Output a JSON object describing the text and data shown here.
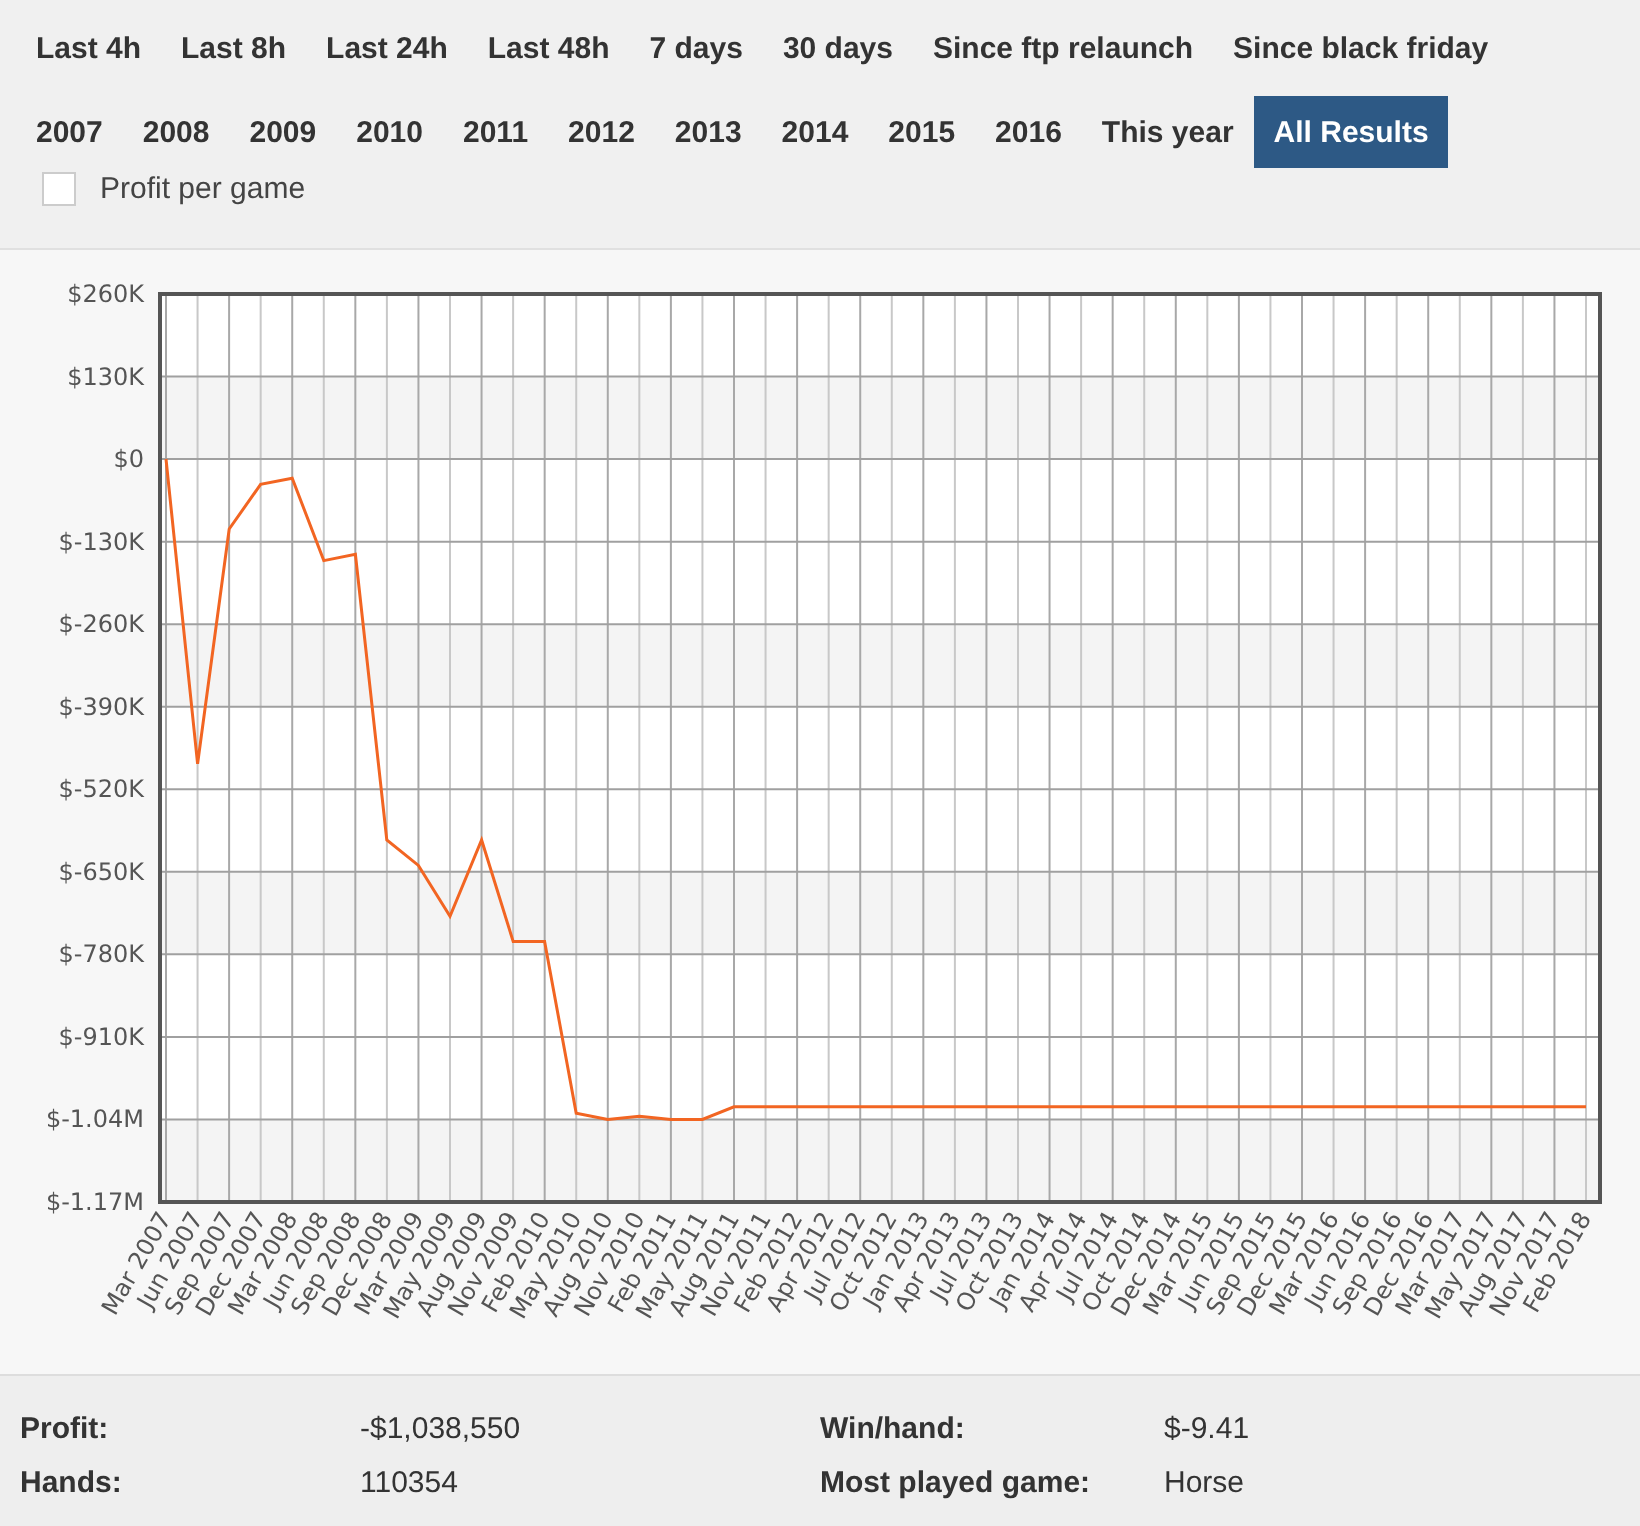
{
  "periods": [
    {
      "label": "Last 4h",
      "selected": false
    },
    {
      "label": "Last 8h",
      "selected": false
    },
    {
      "label": "Last 24h",
      "selected": false
    },
    {
      "label": "Last 48h",
      "selected": false
    },
    {
      "label": "7 days",
      "selected": false
    },
    {
      "label": "30 days",
      "selected": false
    },
    {
      "label": "Since ftp relaunch",
      "selected": false
    },
    {
      "label": "Since black friday",
      "selected": false
    }
  ],
  "years": [
    {
      "label": "2007",
      "selected": false
    },
    {
      "label": "2008",
      "selected": false
    },
    {
      "label": "2009",
      "selected": false
    },
    {
      "label": "2010",
      "selected": false
    },
    {
      "label": "2011",
      "selected": false
    },
    {
      "label": "2012",
      "selected": false
    },
    {
      "label": "2013",
      "selected": false
    },
    {
      "label": "2014",
      "selected": false
    },
    {
      "label": "2015",
      "selected": false
    },
    {
      "label": "2016",
      "selected": false
    },
    {
      "label": "This year",
      "selected": false
    },
    {
      "label": "All Results",
      "selected": true
    }
  ],
  "profit_per_game": {
    "label": "Profit per game",
    "checked": false
  },
  "chart_data": {
    "type": "line",
    "categories": [
      "Mar 2007",
      "Jun 2007",
      "Sep 2007",
      "Dec 2007",
      "Mar 2008",
      "Jun 2008",
      "Sep 2008",
      "Dec 2008",
      "Mar 2009",
      "May 2009",
      "Aug 2009",
      "Nov 2009",
      "Feb 2010",
      "May 2010",
      "Aug 2010",
      "Nov 2010",
      "Feb 2011",
      "May 2011",
      "Aug 2011",
      "Nov 2011",
      "Feb 2012",
      "Apr 2012",
      "Jul 2012",
      "Oct 2012",
      "Jan 2013",
      "Apr 2013",
      "Jul 2013",
      "Oct 2013",
      "Jan 2014",
      "Apr 2014",
      "Jul 2014",
      "Oct 2014",
      "Dec 2014",
      "Mar 2015",
      "Jun 2015",
      "Sep 2015",
      "Dec 2015",
      "Mar 2016",
      "Jun 2016",
      "Sep 2016",
      "Dec 2016",
      "Mar 2017",
      "May 2017",
      "Aug 2017",
      "Nov 2017",
      "Feb 2018"
    ],
    "grid": true,
    "series": [
      {
        "color": "#f26522",
        "values": [
          0,
          -480000,
          -110000,
          -40000,
          -30000,
          -160000,
          -150000,
          -600000,
          -640000,
          -720000,
          -600000,
          -760000,
          -760000,
          -1030000,
          -1040000,
          -1035000,
          -1040000,
          -1040000,
          -1020000,
          -1020000,
          -1020000,
          -1020000,
          -1020000,
          -1020000,
          -1020000,
          -1020000,
          -1020000,
          -1020000,
          -1020000,
          -1020000,
          -1020000,
          -1020000,
          -1020000,
          -1020000,
          -1020000,
          -1020000,
          -1020000,
          -1020000,
          -1020000,
          -1020000,
          -1020000,
          -1020000,
          -1020000,
          -1020000,
          -1020000,
          -1020000
        ]
      }
    ],
    "ylim": [
      -1170000,
      260000
    ],
    "yticks": [
      {
        "value": 260000,
        "label": "$260K"
      },
      {
        "value": 130000,
        "label": "$130K"
      },
      {
        "value": 0,
        "label": "$0"
      },
      {
        "value": -130000,
        "label": "$-130K"
      },
      {
        "value": -260000,
        "label": "$-260K"
      },
      {
        "value": -390000,
        "label": "$-390K"
      },
      {
        "value": -520000,
        "label": "$-520K"
      },
      {
        "value": -650000,
        "label": "$-650K"
      },
      {
        "value": -780000,
        "label": "$-780K"
      },
      {
        "value": -910000,
        "label": "$-910K"
      },
      {
        "value": -1040000,
        "label": "$-1.04M"
      },
      {
        "value": -1170000,
        "label": "$-1.17M"
      }
    ]
  },
  "stats": [
    {
      "label": "Profit:",
      "value": "-$1,038,550"
    },
    {
      "label": "Win/hand:",
      "value": "$-9.41"
    },
    {
      "label": "Hands:",
      "value": "110354"
    },
    {
      "label": "Most played game:",
      "value": "Horse"
    }
  ]
}
